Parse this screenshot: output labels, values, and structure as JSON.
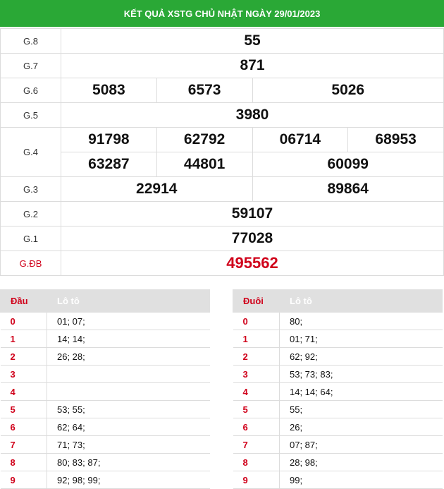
{
  "title": "KẾT QUẢ XSTG CHỦ NHẬT NGÀY 29/01/2023",
  "prizes": {
    "g8": {
      "label": "G.8",
      "numbers": [
        "55"
      ]
    },
    "g7": {
      "label": "G.7",
      "numbers": [
        "871"
      ]
    },
    "g6": {
      "label": "G.6",
      "numbers": [
        "5083",
        "6573",
        "5026"
      ]
    },
    "g5": {
      "label": "G.5",
      "numbers": [
        "3980"
      ]
    },
    "g4": {
      "label": "G.4",
      "numbers": [
        "91798",
        "62792",
        "06714",
        "68953",
        "63287",
        "44801",
        "60099"
      ]
    },
    "g3": {
      "label": "G.3",
      "numbers": [
        "22914",
        "89864"
      ]
    },
    "g2": {
      "label": "G.2",
      "numbers": [
        "59107"
      ]
    },
    "g1": {
      "label": "G.1",
      "numbers": [
        "77028"
      ]
    },
    "gdb": {
      "label": "G.ĐB",
      "numbers": [
        "495562"
      ]
    }
  },
  "dau_table": {
    "header_key": "Đầu",
    "header_val": "Lô tô",
    "rows": [
      {
        "key": "0",
        "val": "01; 07;"
      },
      {
        "key": "1",
        "val": "14; 14;"
      },
      {
        "key": "2",
        "val": "26; 28;"
      },
      {
        "key": "3",
        "val": ""
      },
      {
        "key": "4",
        "val": ""
      },
      {
        "key": "5",
        "val": "53; 55;"
      },
      {
        "key": "6",
        "val": "62; 64;"
      },
      {
        "key": "7",
        "val": "71; 73;"
      },
      {
        "key": "8",
        "val": "80; 83; 87;"
      },
      {
        "key": "9",
        "val": "92; 98; 99;"
      }
    ]
  },
  "duoi_table": {
    "header_key": "Đuôi",
    "header_val": "Lô tô",
    "rows": [
      {
        "key": "0",
        "val": "80;"
      },
      {
        "key": "1",
        "val": "01; 71;"
      },
      {
        "key": "2",
        "val": "62; 92;"
      },
      {
        "key": "3",
        "val": "53; 73; 83;"
      },
      {
        "key": "4",
        "val": "14; 14; 64;"
      },
      {
        "key": "5",
        "val": "55;"
      },
      {
        "key": "6",
        "val": "26;"
      },
      {
        "key": "7",
        "val": "07; 87;"
      },
      {
        "key": "8",
        "val": "28; 98;"
      },
      {
        "key": "9",
        "val": "99;"
      }
    ]
  }
}
